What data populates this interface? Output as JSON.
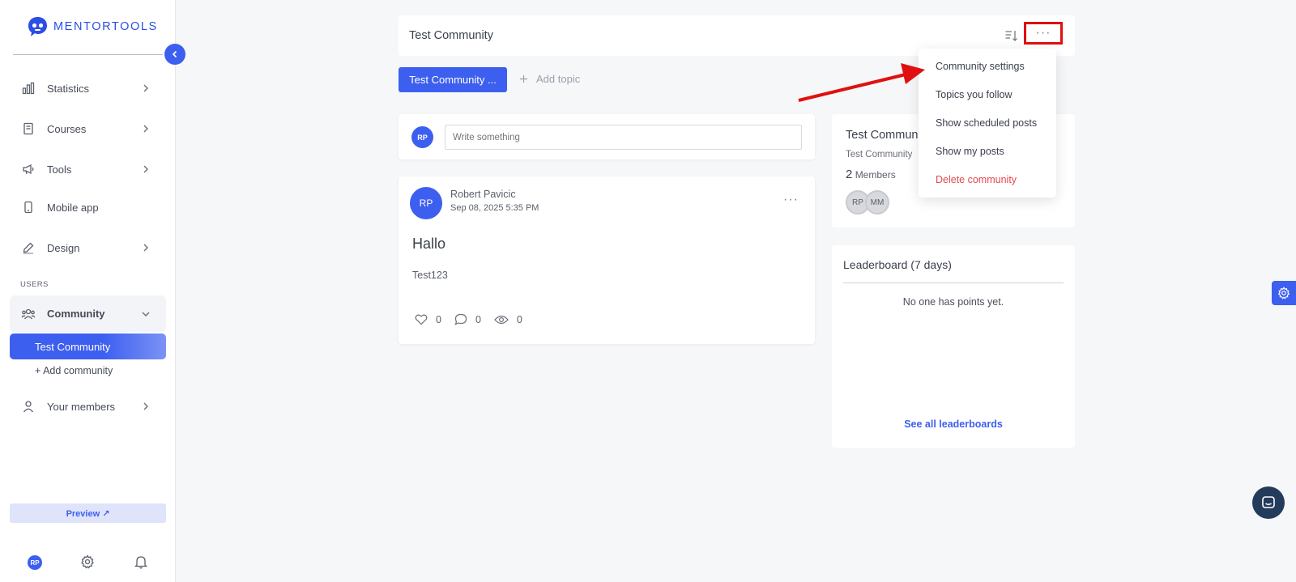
{
  "brand": {
    "name": "MENTORTOOLS",
    "accent": "#3d5ff0"
  },
  "sidebar": {
    "items": [
      {
        "label": "Statistics",
        "icon": "bar-chart-icon"
      },
      {
        "label": "Courses",
        "icon": "book-icon"
      },
      {
        "label": "Tools",
        "icon": "megaphone-icon"
      },
      {
        "label": "Mobile app",
        "icon": "phone-icon"
      },
      {
        "label": "Design",
        "icon": "pencil-icon"
      }
    ],
    "section_users": "USERS",
    "community": {
      "label": "Community",
      "active_sub": "Test Community",
      "add_sub": "+ Add community"
    },
    "your_members": "Your members",
    "preview": "Preview ↗",
    "user_initials": "RP"
  },
  "header": {
    "title": "Test Community",
    "more": "···"
  },
  "topics": {
    "active": "Test Community ...",
    "add": "Add topic"
  },
  "composer": {
    "avatar": "RP",
    "placeholder": "Write something"
  },
  "post": {
    "avatar": "RP",
    "author": "Robert Pavicic",
    "date": "Sep 08, 2025 5:35 PM",
    "title": "Hallo",
    "body": "Test123",
    "likes": "0",
    "comments": "0",
    "views": "0"
  },
  "community_card": {
    "title": "Test Commun",
    "subtitle": "Test Community",
    "member_count": "2",
    "members_label": "Members",
    "members": [
      "RP",
      "MM"
    ]
  },
  "leaderboard": {
    "title": "Leaderboard (7 days)",
    "empty": "No one has points yet.",
    "link": "See all leaderboards"
  },
  "menu": {
    "items": [
      "Community settings",
      "Topics you follow",
      "Show scheduled posts",
      "Show my posts",
      "Delete community"
    ]
  }
}
